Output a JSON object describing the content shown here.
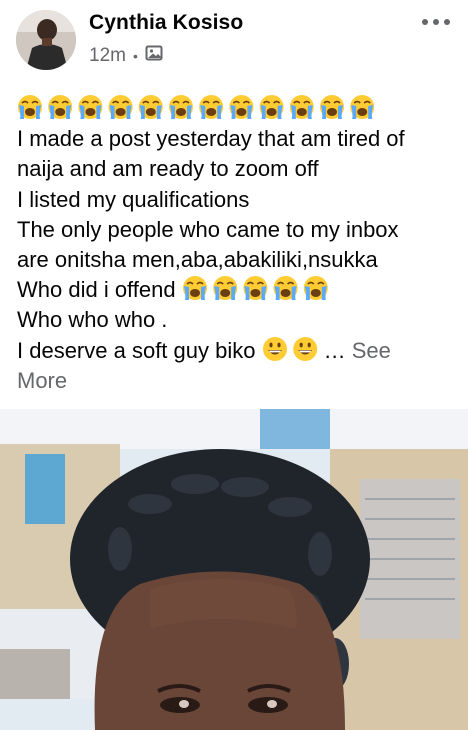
{
  "post": {
    "author": "Cynthia Kosiso",
    "time": "12m",
    "separator": "•",
    "audience_icon": "photo-audience-icon",
    "more_icon": "more-horizontal-icon",
    "emoji_row_1": {
      "icon": "loudly-crying-face",
      "count": 12
    },
    "lines": [
      "I made a post yesterday that am tired of",
      "naija and am ready to zoom off",
      "I listed my qualifications",
      "The only people who came to my inbox",
      "are onitsha men,aba,abakiliki,nsukka",
      "Who did i offend",
      "Who who who .",
      "I deserve a soft guy biko"
    ],
    "emoji_offend": {
      "icon": "loudly-crying-face",
      "count": 5
    },
    "emoji_biko": {
      "icon": "grinning-face",
      "count": 2
    },
    "ellipsis": "…",
    "see_more": "See",
    "see_more_2": "More",
    "colors": {
      "text": "#050505",
      "muted": "#65676b",
      "background": "#ffffff"
    }
  }
}
